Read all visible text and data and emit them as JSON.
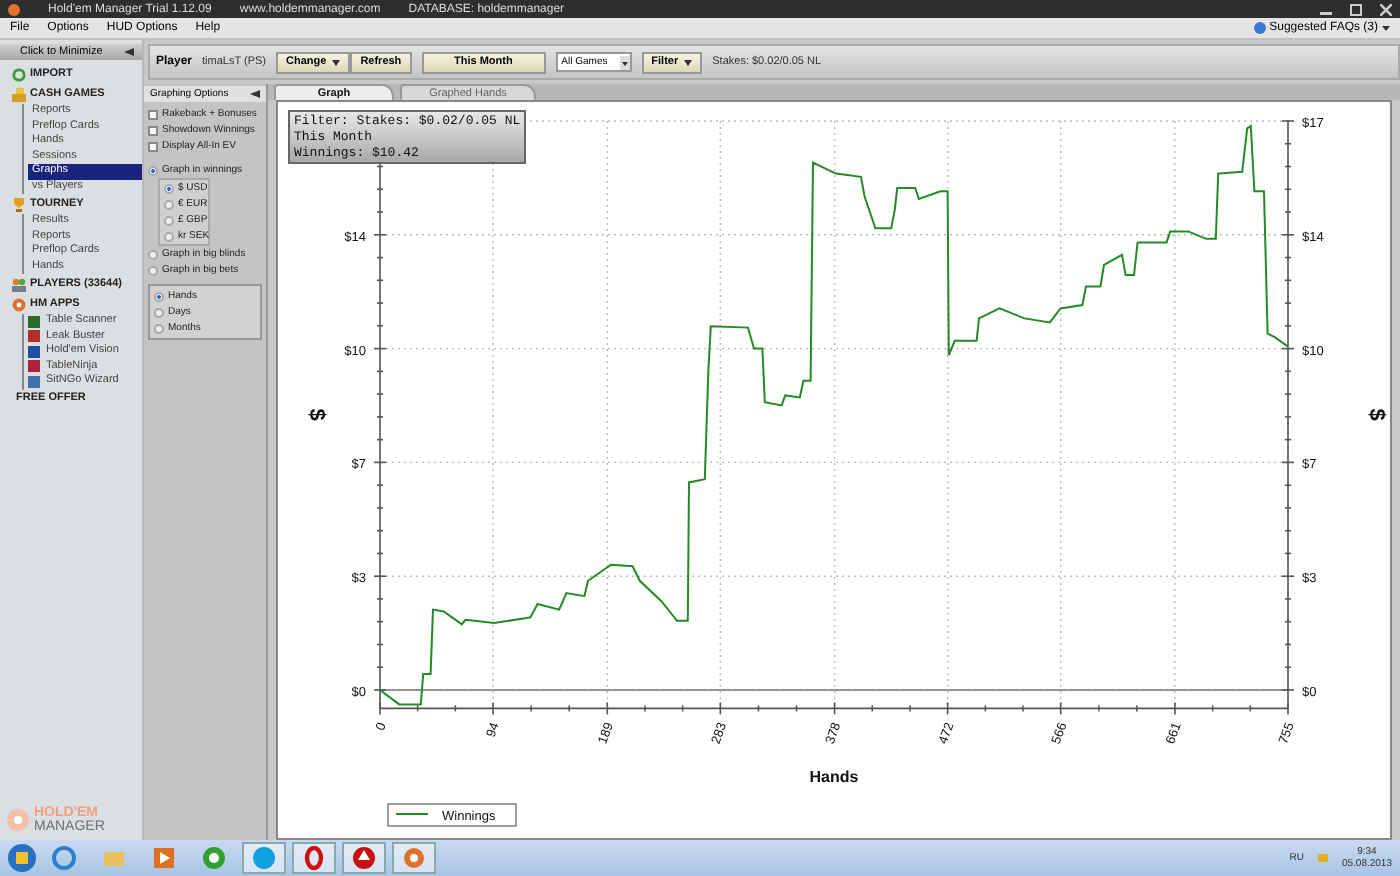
{
  "title_bar": {
    "app": "Hold'em Manager Trial 1.12.09",
    "site": "www.holdemmanager.com",
    "database": "DATABASE: holdemmanager"
  },
  "menu": [
    "File",
    "Options",
    "HUD Options",
    "Help"
  ],
  "faq_link": "Suggested FAQs (3)",
  "sidebar": {
    "header": "Click to Minimize",
    "sections": [
      {
        "label": "IMPORT"
      },
      {
        "label": "CASH GAMES",
        "children": [
          {
            "label": "Reports",
            "selected": false
          },
          {
            "label": "Preflop Cards",
            "selected": false
          },
          {
            "label": "Hands",
            "selected": false
          },
          {
            "label": "Sessions",
            "selected": false
          },
          {
            "label": "Graphs",
            "selected": true
          },
          {
            "label": "vs Players",
            "selected": false
          }
        ]
      },
      {
        "label": "TOURNEY",
        "children": [
          {
            "label": "Results",
            "selected": false
          },
          {
            "label": "Reports",
            "selected": false
          },
          {
            "label": "Preflop Cards",
            "selected": false
          },
          {
            "label": "Hands",
            "selected": false
          }
        ]
      },
      {
        "label": "PLAYERS (33644)"
      },
      {
        "label": "HM APPS",
        "children": [
          {
            "label": "Table Scanner",
            "selected": false
          },
          {
            "label": "Leak Buster",
            "selected": false
          },
          {
            "label": "Hold'em Vision",
            "selected": false
          },
          {
            "label": "TableNinja",
            "selected": false
          },
          {
            "label": "SitNGo Wizard",
            "selected": false
          }
        ]
      },
      {
        "label": "FREE OFFER"
      }
    ],
    "logo": [
      "HOLD'EM",
      "MANAGER"
    ]
  },
  "toolbar": {
    "player_label": "Player",
    "player": "timaLsT (PS)",
    "change": "Change",
    "refresh": "Refresh",
    "period": "This Month",
    "games": "All Games",
    "filter": "Filter",
    "stakes": "Stakes: $0.02/0.05 NL"
  },
  "options": {
    "header": "Graphing Options",
    "checkboxes": [
      {
        "label": "Rakeback + Bonuses",
        "checked": false
      },
      {
        "label": "Showdown Winnings",
        "checked": false
      },
      {
        "label": "Display All-In EV",
        "checked": false
      }
    ],
    "units": [
      {
        "label": "Graph in winnings",
        "selected": true,
        "children": [
          {
            "label": "$ USD",
            "selected": true
          },
          {
            "label": "€ EUR",
            "selected": false
          },
          {
            "label": "£ GBP",
            "selected": false
          },
          {
            "label": "kr SEK",
            "selected": false
          }
        ]
      },
      {
        "label": "Graph in big blinds",
        "selected": false
      },
      {
        "label": "Graph in big bets",
        "selected": false
      }
    ],
    "axis": [
      {
        "label": "Hands",
        "selected": true
      },
      {
        "label": "Days",
        "selected": false
      },
      {
        "label": "Months",
        "selected": false
      }
    ]
  },
  "tabs": [
    {
      "label": "Graph",
      "selected": true
    },
    {
      "label": "Graphed Hands",
      "selected": false
    }
  ],
  "info": [
    "Filter: Stakes: $0.02/0.05 NL",
    "This Month",
    "Winnings: $10.42"
  ],
  "chart_data": {
    "type": "line",
    "grid": true,
    "xlabel": "Hands",
    "ylabel": "$",
    "xlim": [
      0,
      755
    ],
    "ylim": [
      -0.55,
      17
    ],
    "xticks": [
      0,
      94,
      189,
      283,
      378,
      472,
      566,
      661,
      755
    ],
    "yticks": [
      {
        "value": 0,
        "label": "$0"
      },
      {
        "value": 3.4,
        "label": "$3"
      },
      {
        "value": 6.8,
        "label": "$7"
      },
      {
        "value": 10.2,
        "label": "$10"
      },
      {
        "value": 13.6,
        "label": "$14"
      },
      {
        "value": 17,
        "label": "$17"
      }
    ],
    "x": [
      0,
      16,
      34,
      36,
      42,
      44,
      53,
      68,
      71,
      95,
      125,
      131,
      149,
      155,
      170,
      173,
      192,
      210,
      216,
      234,
      247,
      256,
      257,
      270,
      273,
      275,
      306,
      311,
      318,
      320,
      334,
      337,
      349,
      352,
      358,
      360,
      379,
      400,
      403,
      412,
      425,
      428,
      430,
      445,
      448,
      466,
      472,
      473,
      478,
      496,
      498,
      515,
      536,
      557,
      566,
      584,
      587,
      599,
      602,
      617,
      620,
      627,
      630,
      654,
      657,
      672,
      687,
      695,
      697,
      717,
      721,
      724,
      727,
      735,
      738,
      744,
      755
    ],
    "series": [
      {
        "name": "Winnings",
        "color": "#228b22",
        "values": [
          0,
          -0.43,
          -0.43,
          0.48,
          0.48,
          2.4,
          2.35,
          1.96,
          2.1,
          2.0,
          2.17,
          2.57,
          2.4,
          2.9,
          2.8,
          3.26,
          3.74,
          3.7,
          3.26,
          2.65,
          2.07,
          2.07,
          6.2,
          6.3,
          9.57,
          10.87,
          10.83,
          10.2,
          10.2,
          8.6,
          8.5,
          8.8,
          8.74,
          9.24,
          9.24,
          15.76,
          15.43,
          15.33,
          14.74,
          13.8,
          13.8,
          14.35,
          15.0,
          15.0,
          14.67,
          14.9,
          14.9,
          10.0,
          10.43,
          10.43,
          11.1,
          11.4,
          11.1,
          10.98,
          11.4,
          11.5,
          12.06,
          12.06,
          12.7,
          13.0,
          12.4,
          12.4,
          13.37,
          13.37,
          13.7,
          13.7,
          13.48,
          13.48,
          15.43,
          15.48,
          16.78,
          16.85,
          14.9,
          14.9,
          10.65,
          10.54,
          10.26
        ]
      }
    ]
  },
  "taskbar": {
    "language": "RU",
    "time": "9:34",
    "date": "05.08.2013"
  }
}
